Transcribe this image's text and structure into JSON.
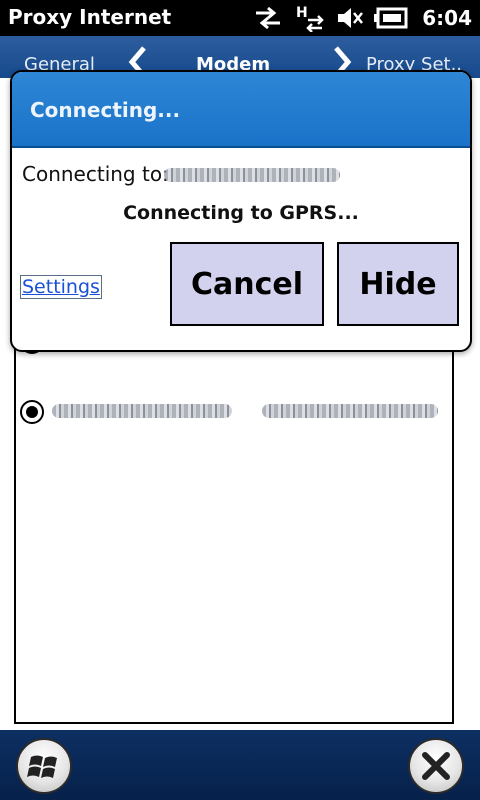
{
  "statusbar": {
    "app_title": "Proxy Internet",
    "time": "6:04",
    "icons": [
      "connection-arrows-icon",
      "hspa-data-icon",
      "volume-muted-icon",
      "battery-icon"
    ]
  },
  "tabs": [
    {
      "label": "General"
    },
    {
      "label": "Modem"
    },
    {
      "label": "Proxy Set.."
    }
  ],
  "dialog": {
    "title": "Connecting...",
    "connecting_to_label": "Connecting to:",
    "status": "Connecting to GPRS...",
    "settings_link": "Settings",
    "cancel_label": "Cancel",
    "hide_label": "Hide"
  },
  "bottombar": {
    "start_icon": "windows-flag-icon",
    "close_icon": "close-x-icon"
  },
  "colors": {
    "dialog_header": "#1a73c8",
    "button_face": "#d3d2ee",
    "link": "#1a4fd8",
    "bottom_bar": "#0d2f62"
  }
}
